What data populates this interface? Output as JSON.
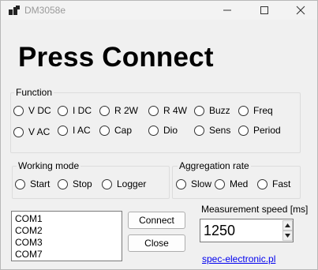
{
  "window": {
    "title": "DM3058e"
  },
  "headline": "Press Connect",
  "function_group": {
    "legend": "Function",
    "row1": [
      "V DC",
      "I DC",
      "R 2W",
      "R 4W",
      "Buzz",
      "Freq"
    ],
    "row2": [
      "V AC",
      "I AC",
      "Cap",
      "Dio",
      "Sens",
      "Period"
    ]
  },
  "working_mode": {
    "legend": "Working mode",
    "options": [
      "Start",
      "Stop",
      "Logger"
    ]
  },
  "aggregation": {
    "legend": "Aggregation rate",
    "options": [
      "Slow",
      "Med",
      "Fast"
    ]
  },
  "ports": [
    "COM1",
    "COM2",
    "COM3",
    "COM7"
  ],
  "buttons": {
    "connect": "Connect",
    "close": "Close"
  },
  "speed": {
    "label": "Measurement speed [ms]",
    "value": "1250"
  },
  "link": "spec-electronic.pl"
}
